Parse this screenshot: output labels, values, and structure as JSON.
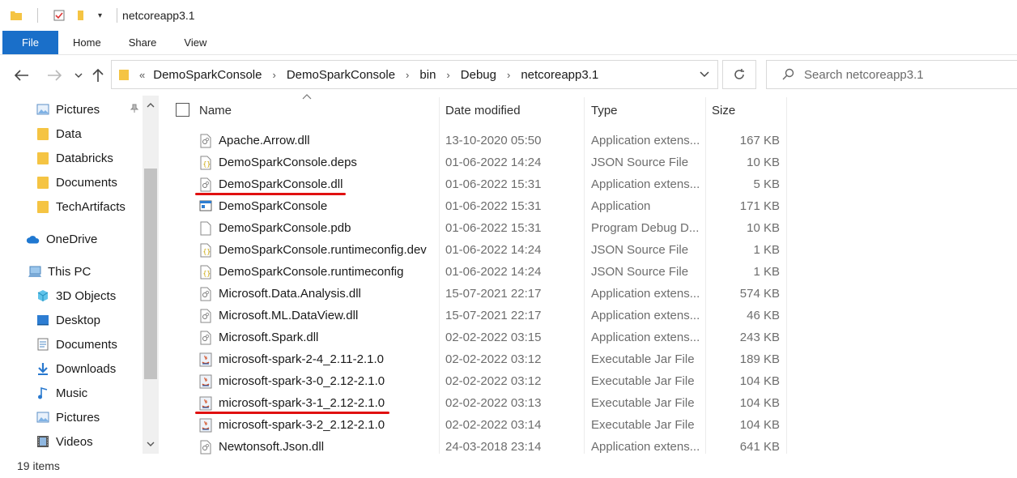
{
  "window": {
    "title": "netcoreapp3.1"
  },
  "ribbon": {
    "tabs": [
      "File",
      "Home",
      "Share",
      "View"
    ]
  },
  "address": {
    "prefix": "«",
    "crumbs": [
      "DemoSparkConsole",
      "DemoSparkConsole",
      "bin",
      "Debug",
      "netcoreapp3.1"
    ]
  },
  "search": {
    "placeholder": "Search netcoreapp3.1"
  },
  "nav": {
    "quick_access": [
      {
        "label": "Pictures",
        "icon": "pictures-icon"
      },
      {
        "label": "Data",
        "icon": "folder-icon"
      },
      {
        "label": "Databricks",
        "icon": "folder-icon"
      },
      {
        "label": "Documents",
        "icon": "folder-icon"
      },
      {
        "label": "TechArtifacts",
        "icon": "folder-icon"
      }
    ],
    "onedrive": "OneDrive",
    "thispc": "This PC",
    "thispc_items": [
      {
        "label": "3D Objects",
        "icon": "3d-objects-icon"
      },
      {
        "label": "Desktop",
        "icon": "desktop-icon"
      },
      {
        "label": "Documents",
        "icon": "documents-icon"
      },
      {
        "label": "Downloads",
        "icon": "downloads-icon"
      },
      {
        "label": "Music",
        "icon": "music-icon"
      },
      {
        "label": "Pictures",
        "icon": "pictures-icon"
      },
      {
        "label": "Videos",
        "icon": "videos-icon"
      }
    ]
  },
  "columns": {
    "name": "Name",
    "date": "Date modified",
    "type": "Type",
    "size": "Size"
  },
  "files": [
    {
      "name": "Apache.Arrow.dll",
      "date": "13-10-2020 05:50",
      "type": "Application extens...",
      "size": "167 KB",
      "icon": "dll-icon"
    },
    {
      "name": "DemoSparkConsole.deps",
      "date": "01-06-2022 14:24",
      "type": "JSON Source File",
      "size": "10 KB",
      "icon": "json-icon"
    },
    {
      "name": "DemoSparkConsole.dll",
      "date": "01-06-2022 15:31",
      "type": "Application extens...",
      "size": "5 KB",
      "icon": "dll-icon"
    },
    {
      "name": "DemoSparkConsole",
      "date": "01-06-2022 15:31",
      "type": "Application",
      "size": "171 KB",
      "icon": "exe-icon"
    },
    {
      "name": "DemoSparkConsole.pdb",
      "date": "01-06-2022 15:31",
      "type": "Program Debug D...",
      "size": "10 KB",
      "icon": "file-icon"
    },
    {
      "name": "DemoSparkConsole.runtimeconfig.dev",
      "date": "01-06-2022 14:24",
      "type": "JSON Source File",
      "size": "1 KB",
      "icon": "json-icon"
    },
    {
      "name": "DemoSparkConsole.runtimeconfig",
      "date": "01-06-2022 14:24",
      "type": "JSON Source File",
      "size": "1 KB",
      "icon": "json-icon"
    },
    {
      "name": "Microsoft.Data.Analysis.dll",
      "date": "15-07-2021 22:17",
      "type": "Application extens...",
      "size": "574 KB",
      "icon": "dll-icon"
    },
    {
      "name": "Microsoft.ML.DataView.dll",
      "date": "15-07-2021 22:17",
      "type": "Application extens...",
      "size": "46 KB",
      "icon": "dll-icon"
    },
    {
      "name": "Microsoft.Spark.dll",
      "date": "02-02-2022 03:15",
      "type": "Application extens...",
      "size": "243 KB",
      "icon": "dll-icon"
    },
    {
      "name": "microsoft-spark-2-4_2.11-2.1.0",
      "date": "02-02-2022 03:12",
      "type": "Executable Jar File",
      "size": "189 KB",
      "icon": "jar-icon"
    },
    {
      "name": "microsoft-spark-3-0_2.12-2.1.0",
      "date": "02-02-2022 03:12",
      "type": "Executable Jar File",
      "size": "104 KB",
      "icon": "jar-icon"
    },
    {
      "name": "microsoft-spark-3-1_2.12-2.1.0",
      "date": "02-02-2022 03:13",
      "type": "Executable Jar File",
      "size": "104 KB",
      "icon": "jar-icon"
    },
    {
      "name": "microsoft-spark-3-2_2.12-2.1.0",
      "date": "02-02-2022 03:14",
      "type": "Executable Jar File",
      "size": "104 KB",
      "icon": "jar-icon"
    },
    {
      "name": "Newtonsoft.Json.dll",
      "date": "24-03-2018 23:14",
      "type": "Application extens...",
      "size": "641 KB",
      "icon": "dll-icon"
    }
  ],
  "annotations": {
    "underline_color": "#e01010",
    "underlined_files": [
      "DemoSparkConsole.dll",
      "microsoft-spark-3-1_2.12-2.1.0"
    ]
  },
  "status": {
    "item_count": "19 items"
  },
  "colors": {
    "file_tab": "#1a6fc9",
    "folder": "#f5c443",
    "secondary_text": "#6d6d6d"
  }
}
